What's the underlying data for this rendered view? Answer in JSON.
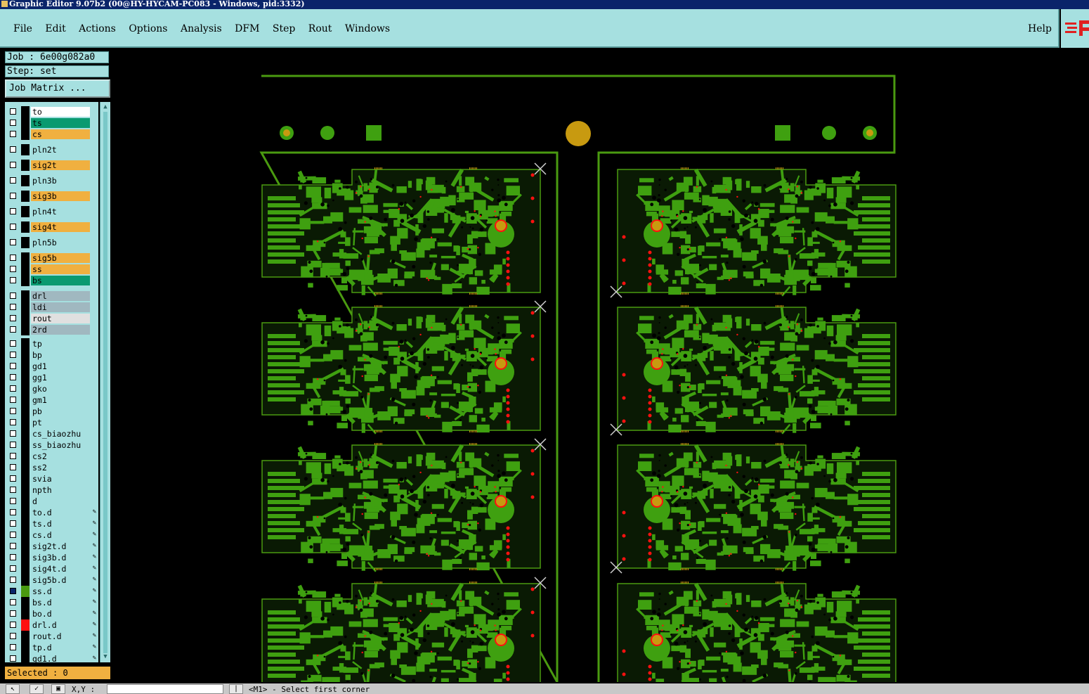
{
  "window": {
    "title": "Graphic Editor 9.07b2 (00@HY-HYCAM-PC083 - Windows, pid:3332)"
  },
  "menu": {
    "items": [
      "File",
      "Edit",
      "Actions",
      "Options",
      "Analysis",
      "DFM",
      "Step",
      "Rout",
      "Windows"
    ],
    "help": "Help"
  },
  "job": {
    "label": "Job : 6e00g082a0",
    "step": "Step: set",
    "matrix_button": "Job Matrix ..."
  },
  "layers": [
    {
      "name": "to",
      "color": "#ffffff"
    },
    {
      "name": "ts",
      "color": "#0a9a70"
    },
    {
      "name": "cs",
      "color": "#f0b040"
    },
    {
      "name": "pln2t",
      "color": "#a6e0e0"
    },
    {
      "name": "sig2t",
      "color": "#f0b040"
    },
    {
      "name": "pln3b",
      "color": "#a6e0e0"
    },
    {
      "name": "sig3b",
      "color": "#f0b040"
    },
    {
      "name": "pln4t",
      "color": "#a6e0e0"
    },
    {
      "name": "sig4t",
      "color": "#f0b040"
    },
    {
      "name": "pln5b",
      "color": "#a6e0e0"
    },
    {
      "name": "sig5b",
      "color": "#f0b040"
    },
    {
      "name": "ss",
      "color": "#f0b040"
    },
    {
      "name": "bs",
      "color": "#0a9a70"
    },
    {
      "name": "drl",
      "color": "#a0b8c0"
    },
    {
      "name": "ldi",
      "color": "#a0b8c0"
    },
    {
      "name": "rout",
      "color": "#e0e0e0"
    },
    {
      "name": "2rd",
      "color": "#a0b8c0"
    },
    {
      "name": "tp",
      "color": "#a6e0e0"
    },
    {
      "name": "bp",
      "color": "#a6e0e0"
    },
    {
      "name": "gd1",
      "color": "#a6e0e0"
    },
    {
      "name": "gg1",
      "color": "#a6e0e0"
    },
    {
      "name": "gko",
      "color": "#a6e0e0"
    },
    {
      "name": "gm1",
      "color": "#a6e0e0"
    },
    {
      "name": "pb",
      "color": "#a6e0e0"
    },
    {
      "name": "pt",
      "color": "#a6e0e0"
    },
    {
      "name": "cs_biaozhu",
      "color": "#a6e0e0"
    },
    {
      "name": "ss_biaozhu",
      "color": "#a6e0e0"
    },
    {
      "name": "cs2",
      "color": "#a6e0e0"
    },
    {
      "name": "ss2",
      "color": "#a6e0e0"
    },
    {
      "name": "svia",
      "color": "#a6e0e0"
    },
    {
      "name": "npth",
      "color": "#a6e0e0"
    },
    {
      "name": "d",
      "color": "#a6e0e0"
    },
    {
      "name": "to.d",
      "color": "#a6e0e0"
    },
    {
      "name": "ts.d",
      "color": "#a6e0e0"
    },
    {
      "name": "cs.d",
      "color": "#a6e0e0"
    },
    {
      "name": "sig2t.d",
      "color": "#a6e0e0"
    },
    {
      "name": "sig3b.d",
      "color": "#a6e0e0"
    },
    {
      "name": "sig4t.d",
      "color": "#a6e0e0"
    },
    {
      "name": "sig5b.d",
      "color": "#a6e0e0"
    },
    {
      "name": "ss.d",
      "color": "#a6e0e0"
    },
    {
      "name": "bs.d",
      "color": "#a6e0e0"
    },
    {
      "name": "bo.d",
      "color": "#a6e0e0"
    },
    {
      "name": "drl.d",
      "color": "#a6e0e0"
    },
    {
      "name": "rout.d",
      "color": "#a6e0e0"
    },
    {
      "name": "tp.d",
      "color": "#a6e0e0"
    },
    {
      "name": "gd1.d",
      "color": "#a6e0e0"
    }
  ],
  "selected_count": "Selected : 0",
  "bottom": {
    "xy_label": "X,Y :",
    "prompt": "<M1> - Select first corner"
  },
  "colors": {
    "board_green": "#4a9a10",
    "copper_green": "#3fa010",
    "pad_gold": "#c89a10",
    "drill_red": "#ff1010",
    "panel_cyan": "#a6e0e0"
  }
}
